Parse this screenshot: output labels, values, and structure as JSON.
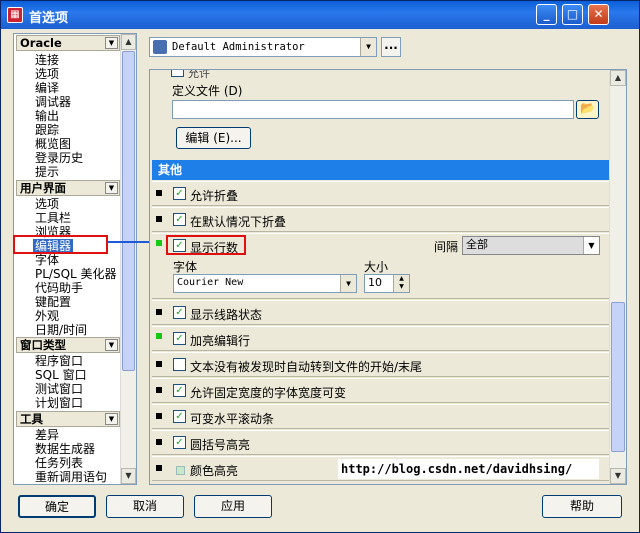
{
  "window": {
    "title": "首选项"
  },
  "left_panel": {
    "groups": [
      {
        "label": "Oracle",
        "items": [
          "连接",
          "选项",
          "编译",
          "调试器",
          "输出",
          "跟踪",
          "概览图",
          "登录历史",
          "提示"
        ]
      },
      {
        "label": "用户界面",
        "items": [
          "选项",
          "工具栏",
          "浏览器",
          "编辑器",
          "字体",
          "PL/SQL 美化器",
          "代码助手",
          "键配置",
          "外观",
          "日期/时间"
        ]
      },
      {
        "label": "窗口类型",
        "items": [
          "程序窗口",
          "SQL 窗口",
          "测试窗口",
          "计划窗口"
        ]
      },
      {
        "label": "工具",
        "items": [
          "差异",
          "数据生成器",
          "任务列表",
          "重新调用语句"
        ]
      }
    ],
    "selected_item": "编辑器"
  },
  "top": {
    "profile": "Default Administrator",
    "more_button": "..."
  },
  "right_panel": {
    "partial_top_label": "允许",
    "define_file_label": "定义文件 (D)",
    "define_file_value": "",
    "edit_button": "编辑 (E)...",
    "section_other": "其他",
    "options": {
      "allow_fold": "允许折叠",
      "fold_default": "在默认情况下折叠",
      "show_line_numbers": "显示行数",
      "interval_label": "间隔",
      "interval_value": "全部",
      "font_label": "字体",
      "font_value": "Courier New",
      "size_label": "大小",
      "size_value": "10",
      "show_line_state": "显示线路状态",
      "highlight_edit_line": "加亮编辑行",
      "auto_wrap_text": "文本没有被发现时自动转到文件的开始/末尾",
      "fixed_width_font": "允许固定宽度的字体宽度可变",
      "variable_hscroll": "可变水平滚动条",
      "bracket_highlight": "圆括号高亮",
      "color_highlight": "颜色高亮"
    }
  },
  "watermark": "http://blog.csdn.net/davidhsing/",
  "footer": {
    "ok": "确定",
    "cancel": "取消",
    "apply": "应用",
    "help": "帮助"
  },
  "colors": {
    "section": "#1e7fe8",
    "selection": "#316ac5",
    "highlight_box": "#e01010",
    "arrow": "#1e5ad8"
  }
}
